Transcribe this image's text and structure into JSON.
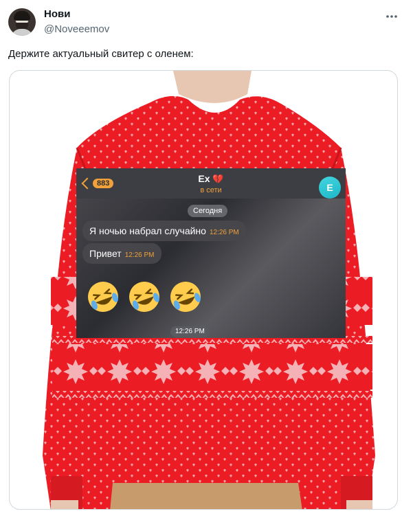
{
  "tweet": {
    "author_name": "Нови",
    "author_handle": "@Noveeemov",
    "text": "Держите актуальный свитер с оленем:"
  },
  "icons": {
    "more": "more-horizontal-icon",
    "avatar": "avatar-icon"
  },
  "chat": {
    "back_count": "883",
    "contact_name": "Ex",
    "contact_emoji": "💔",
    "status": "в сети",
    "avatar_letter": "E",
    "date_label": "Сегодня",
    "messages": [
      {
        "text": "Я ночью набрал случайно",
        "time": "12:26 PM"
      },
      {
        "text": "Привет",
        "time": "12:26 PM"
      }
    ],
    "emoji_message_time": "12:26 PM",
    "emoji_count": 3
  },
  "colors": {
    "sweater_red": "#ec1c24",
    "chat_accent": "#f0a13a",
    "chat_avatar": "#2fc6d3",
    "text_primary": "#0f1419",
    "text_secondary": "#536471"
  }
}
